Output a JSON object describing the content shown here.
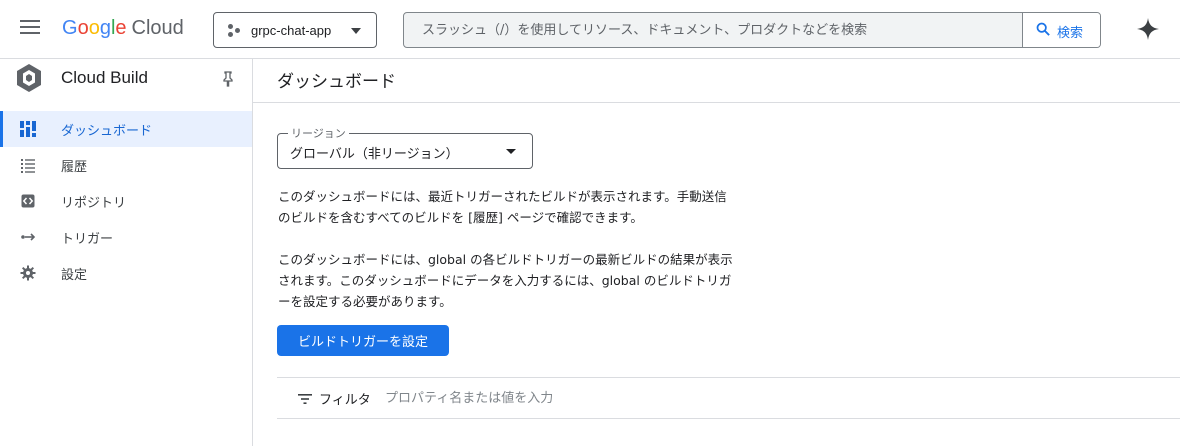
{
  "header": {
    "logo_google_letters": [
      "G",
      "o",
      "o",
      "g",
      "l",
      "e"
    ],
    "logo_product": "Cloud",
    "project_name": "grpc-chat-app",
    "search_placeholder": "スラッシュ（/）を使用してリソース、ドキュメント、プロダクトなどを検索",
    "search_button_label": "検索",
    "icons": [
      "hamburger-menu-icon",
      "project-icon",
      "search-icon",
      "gemini-spark-icon"
    ]
  },
  "sidebar": {
    "product_title": "Cloud Build",
    "items": [
      {
        "label": "ダッシュボード",
        "icon": "dashboard-icon",
        "active": true
      },
      {
        "label": "履歴",
        "icon": "list-icon",
        "active": false
      },
      {
        "label": "リポジトリ",
        "icon": "repository-icon",
        "active": false
      },
      {
        "label": "トリガー",
        "icon": "trigger-arrow-icon",
        "active": false
      },
      {
        "label": "設定",
        "icon": "gear-icon",
        "active": false
      }
    ]
  },
  "main": {
    "title": "ダッシュボード",
    "region": {
      "label": "リージョン",
      "value": "グローバル（非リージョン）"
    },
    "paragraph1_line1": "このダッシュボードには、最近トリガーされたビルドが表示されます。手動送信",
    "paragraph1_line2": "のビルドを含むすべてのビルドを [履歴] ページで確認できます。",
    "paragraph2_line1": "このダッシュボードには、global の各ビルドトリガーの最新ビルドの結果が表示",
    "paragraph2_line2": "されます。このダッシュボードにデータを入力するには、global のビルドトリガ",
    "paragraph2_line3": "ーを設定する必要があります。",
    "setup_button_label": "ビルドトリガーを設定",
    "filter": {
      "label": "フィルタ",
      "placeholder": "プロパティ名または値を入力"
    }
  },
  "colors": {
    "accent": "#1a73e8",
    "active_bg": "#e8f0fe",
    "border": "#dadce0"
  }
}
